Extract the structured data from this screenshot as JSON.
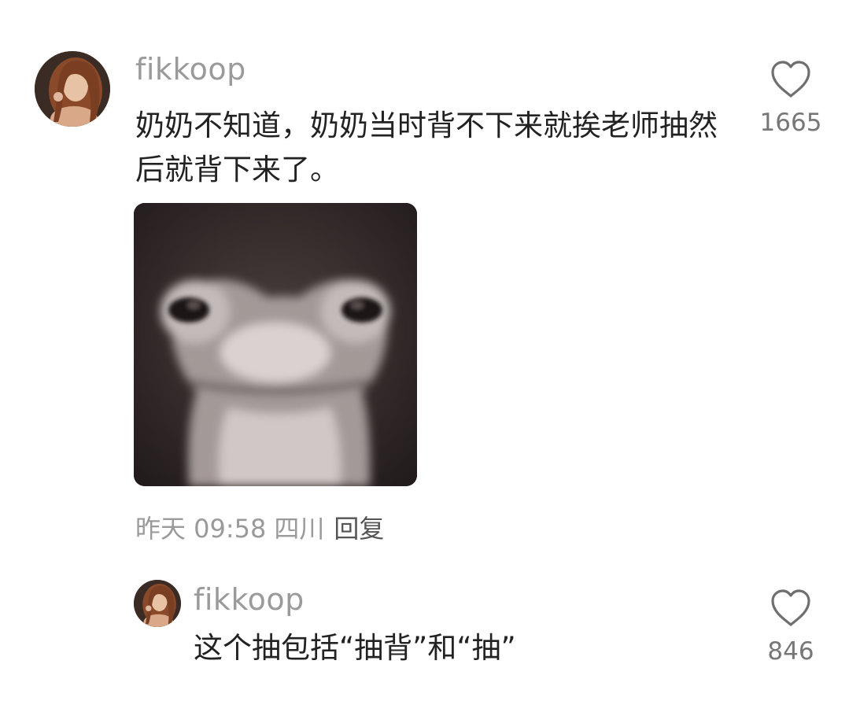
{
  "comment": {
    "username": "fikkoop",
    "text": "奶奶不知道，奶奶当时背不下来就挨老师抽然后就背下来了。",
    "time": "昨天 09:58",
    "location": "四川",
    "reply_label": "回复",
    "like_count": "1665",
    "image": "frog-meme-image"
  },
  "reply": {
    "username": "fikkoop",
    "text": "这个抽包括“抽背”和“抽”",
    "like_count": "846"
  },
  "icons": {
    "like": "heart-icon"
  },
  "colors": {
    "username": "#9a9a9a",
    "text": "#222222",
    "meta": "#9a9a9a",
    "like_count": "#777777"
  }
}
